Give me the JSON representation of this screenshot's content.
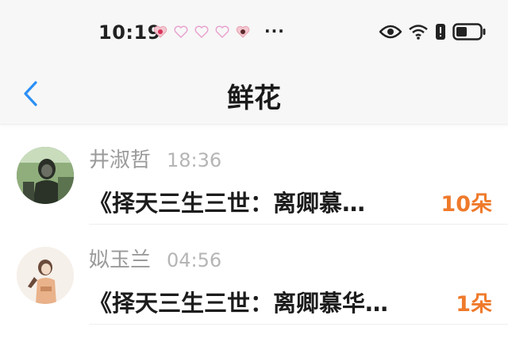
{
  "status_bar": {
    "time": "10:19",
    "notification_icons": [
      "notification-app-icon",
      "heart-icon",
      "heart-icon",
      "heart-icon",
      "notification-app-icon"
    ],
    "more": "···",
    "system_icons": [
      "eye-icon",
      "wifi-icon",
      "alert-icon",
      "battery-icon"
    ]
  },
  "nav": {
    "title": "鲜花",
    "back_icon": "chevron-left-icon"
  },
  "messages": [
    {
      "name": "井淑哲",
      "time": "18:36",
      "text": "《择天三生三世：离卿慕…",
      "count": "10朵"
    },
    {
      "name": "姒玉兰",
      "time": "04:56",
      "text": "《择天三生三世：离卿慕华…",
      "count": "1朵"
    }
  ],
  "colors": {
    "accent_back": "#2b8ff5",
    "count": "#ef7a2b",
    "bar_bg": "#f7f7f7"
  }
}
